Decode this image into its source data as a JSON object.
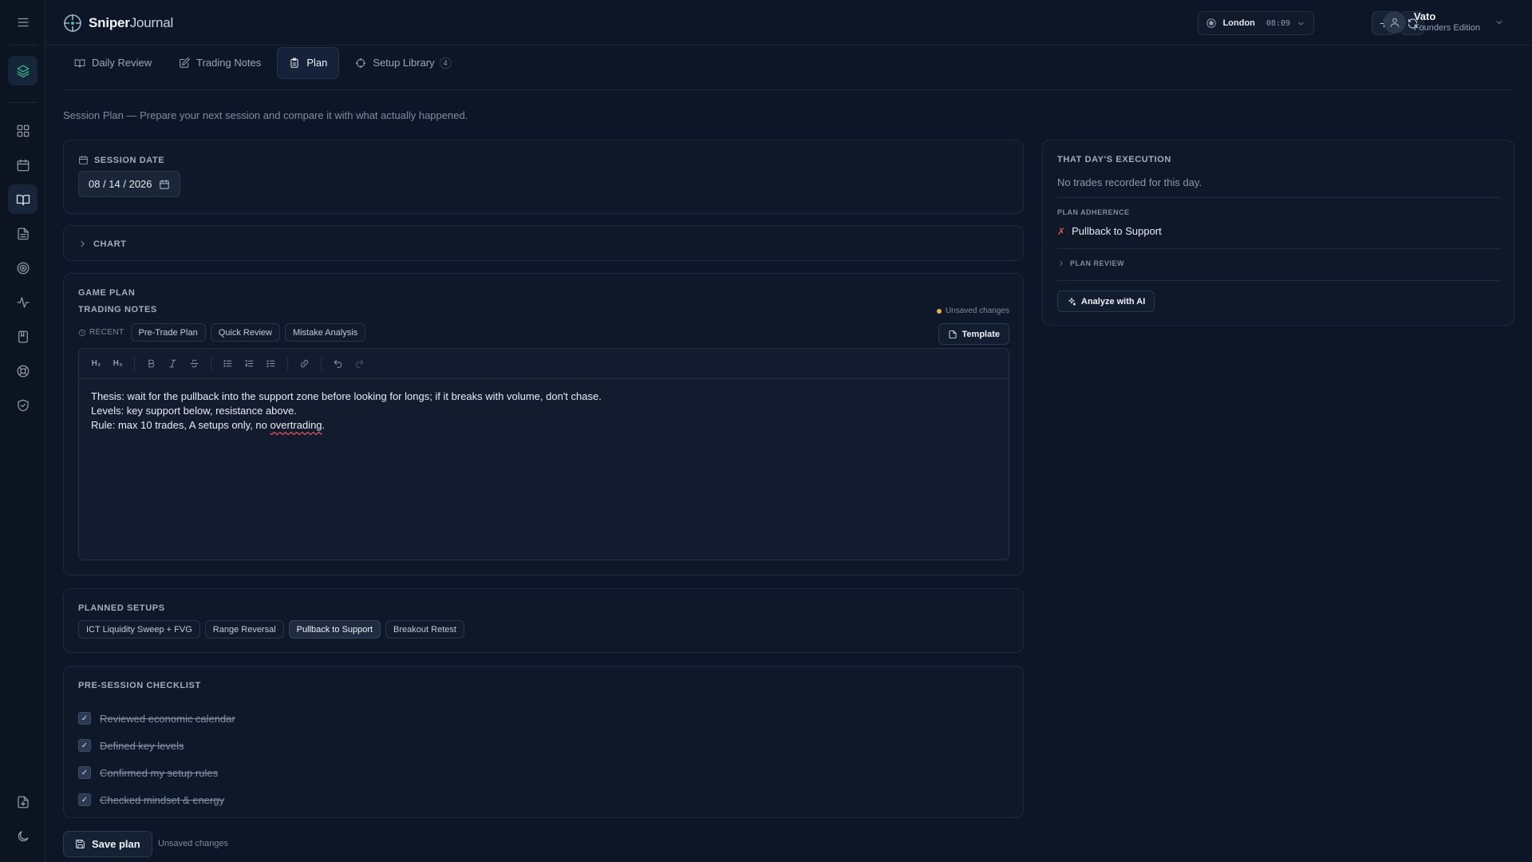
{
  "app": {
    "brand_primary": "Sniper",
    "brand_secondary": "Journal"
  },
  "header": {
    "session_city": "London",
    "session_time": "08:09",
    "user_name": "Vato",
    "user_edition": "Founders Edition"
  },
  "tabs": [
    {
      "label": "Daily Review"
    },
    {
      "label": "Trading Notes"
    },
    {
      "label": "Plan"
    },
    {
      "label": "Setup Library",
      "count": "4"
    }
  ],
  "page": {
    "subtitle": "Session Plan — Prepare your next session and compare it with what actually happened."
  },
  "session_date": {
    "label": "SESSION DATE",
    "value": "08 / 14 / 2026"
  },
  "chart_section": {
    "label": "CHART"
  },
  "game_plan": {
    "label": "GAME PLAN",
    "notes_label": "TRADING NOTES",
    "unsaved": "Unsaved changes",
    "recent_label": "RECENT",
    "recent_templates": [
      "Pre-Trade Plan",
      "Quick Review",
      "Mistake Analysis"
    ],
    "template_button": "Template",
    "toolbar": {
      "h2": "H₂",
      "h3": "H₃"
    },
    "lines": [
      "Thesis: wait for the pullback into the support zone before looking for longs; if it breaks with volume, don't chase.",
      "Levels: key support below, resistance above."
    ],
    "line3_before": "Rule: max 10 trades, A setups only, no ",
    "line3_misspelled": "overtrading",
    "line3_after": "."
  },
  "planned_setups": {
    "label": "PLANNED SETUPS",
    "items": [
      {
        "label": "ICT Liquidity Sweep + FVG",
        "selected": false
      },
      {
        "label": "Range Reversal",
        "selected": false
      },
      {
        "label": "Pullback to Support",
        "selected": true
      },
      {
        "label": "Breakout Retest",
        "selected": false
      }
    ]
  },
  "checklist": {
    "label": "PRE-SESSION CHECKLIST",
    "items": [
      {
        "label": "Reviewed economic calendar",
        "checked": true
      },
      {
        "label": "Defined key levels",
        "checked": true
      },
      {
        "label": "Confirmed my setup rules",
        "checked": true
      },
      {
        "label": "Checked mindset & energy",
        "checked": true
      }
    ]
  },
  "footer": {
    "save_label": "Save plan",
    "status": "Unsaved changes"
  },
  "execution": {
    "label": "THAT DAY'S EXECUTION",
    "empty": "No trades recorded for this day.",
    "adherence_label": "PLAN ADHERENCE",
    "adherence_mark": "✗",
    "adherence_item": "Pullback to Support",
    "review_label": "PLAN REVIEW",
    "analyze_button": "Analyze with AI"
  },
  "colors": {
    "background": "#0d1626",
    "accent_green": "#37c08f",
    "unsaved_dot": "#e3b23b",
    "fail_red": "#e05252"
  }
}
